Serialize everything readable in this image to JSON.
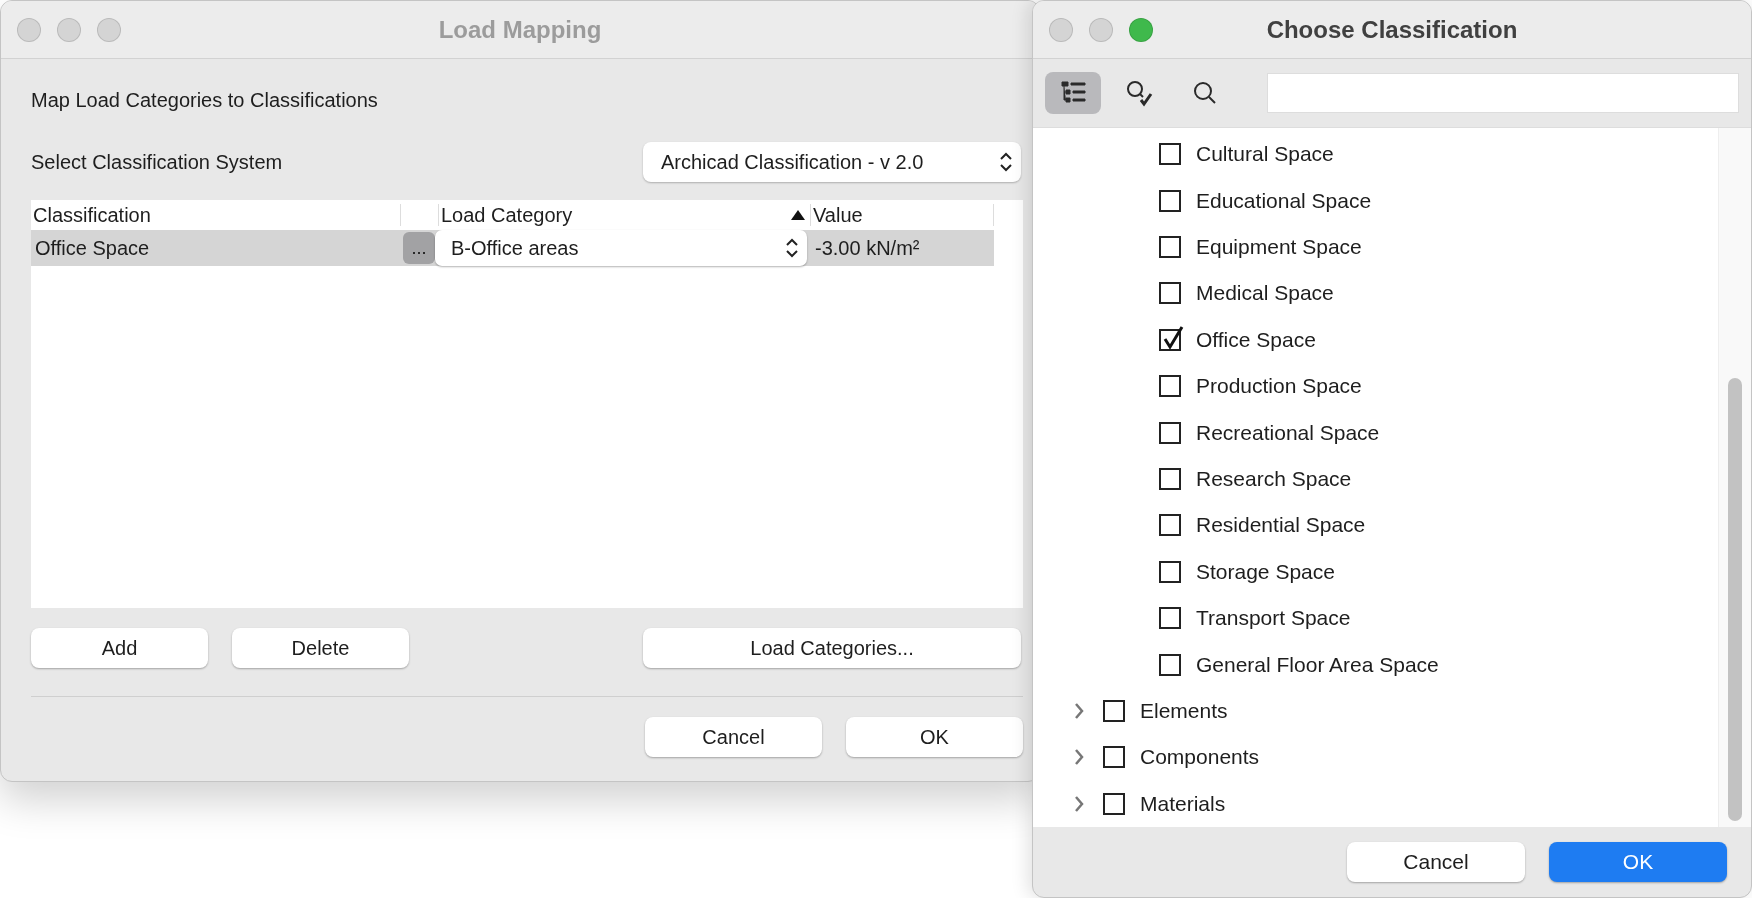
{
  "load_mapping_window": {
    "title": "Load Mapping",
    "lights": [
      {
        "color": "#d4d4d4"
      },
      {
        "color": "#d4d4d4"
      },
      {
        "color": "#d4d4d4"
      }
    ],
    "heading": "Map Load Categories to Classifications",
    "system_label": "Select Classification System",
    "system_select": "Archicad Classification - v 2.0",
    "table": {
      "columns": [
        {
          "label": "Classification",
          "sorted": false
        },
        {
          "sorted": false
        },
        {
          "label": "Load Category",
          "sorted": true
        },
        {
          "label": "Value",
          "sorted": false
        }
      ],
      "rows": [
        {
          "classification": "Office Space",
          "more": "...",
          "load_category": "B-Office areas",
          "value": "-3.00 kN/m²",
          "selected": true
        }
      ]
    },
    "buttons": [
      "Add",
      "Delete"
    ],
    "load_categories_button": "Load Categories...",
    "footer_buttons": [
      "Cancel",
      "OK"
    ]
  },
  "choose_classification_window": {
    "title": "Choose Classification",
    "lights": [
      {
        "color": "#d4d4d4"
      },
      {
        "color": "#d4d4d4"
      },
      {
        "color": "#3fb94c"
      }
    ],
    "toolbar": [
      {
        "kind": "tree",
        "selected": true
      },
      {
        "kind": "search-check",
        "selected": false
      },
      {
        "kind": "search",
        "selected": false
      }
    ],
    "space_items": [
      {
        "label": "Cultural Space",
        "checked": false
      },
      {
        "label": "Educational Space",
        "checked": false
      },
      {
        "label": "Equipment Space",
        "checked": false
      },
      {
        "label": "Medical Space",
        "checked": false
      },
      {
        "label": "Office Space",
        "checked": true
      },
      {
        "label": "Production Space",
        "checked": false
      },
      {
        "label": "Recreational Space",
        "checked": false
      },
      {
        "label": "Research Space",
        "checked": false
      },
      {
        "label": "Residential Space",
        "checked": false
      },
      {
        "label": "Storage Space",
        "checked": false
      },
      {
        "label": "Transport Space",
        "checked": false
      },
      {
        "label": "General Floor Area Space",
        "checked": false
      }
    ],
    "root_items": [
      {
        "label": "Elements",
        "checked": false,
        "expanded": false
      },
      {
        "label": "Components",
        "checked": false,
        "expanded": false
      },
      {
        "label": "Materials",
        "checked": false,
        "expanded": false
      }
    ],
    "footer_buttons": [
      {
        "label": "Cancel",
        "default": false
      },
      {
        "label": "OK",
        "default": true
      }
    ]
  }
}
